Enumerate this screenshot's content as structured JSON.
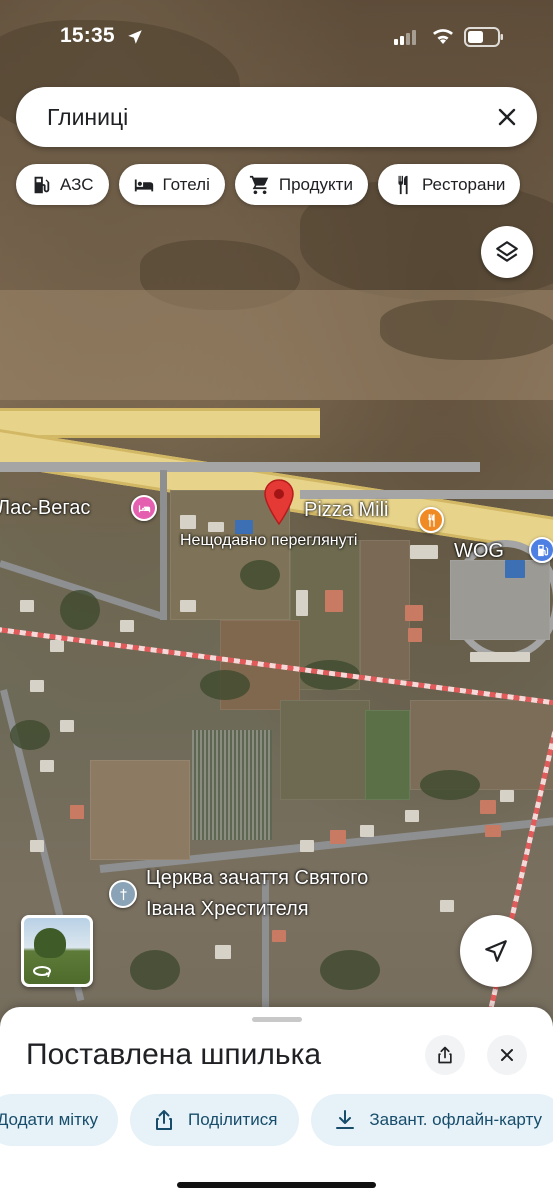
{
  "status_bar": {
    "time": "15:35"
  },
  "search": {
    "query": "Глиниці"
  },
  "chips": [
    {
      "icon": "gas-station-icon",
      "label": "АЗС"
    },
    {
      "icon": "bed-icon",
      "label": "Готелі"
    },
    {
      "icon": "cart-icon",
      "label": "Продукти"
    },
    {
      "icon": "fork-knife-icon",
      "label": "Ресторани"
    }
  ],
  "map": {
    "labels": {
      "hotel": "Лас-Вегас",
      "restaurant": "Pizza Mili",
      "recently_viewed": "Нещодавно переглянуті",
      "gas_station": "WOG",
      "church_line1": "Церква зачаття Святого",
      "church_line2": "Івана Хрестителя"
    },
    "colors": {
      "hotel": "#e55fb0",
      "restaurant": "#f08a24",
      "gas": "#4e7fe3",
      "pin": "#e53935"
    }
  },
  "sheet": {
    "title": "Поставлена шпилька",
    "actions": [
      {
        "icon": "label-icon",
        "label": "Додати мітку"
      },
      {
        "icon": "share-icon",
        "label": "Поділитися"
      },
      {
        "icon": "download-icon",
        "label": "Завант. офлайн-карту"
      }
    ]
  }
}
